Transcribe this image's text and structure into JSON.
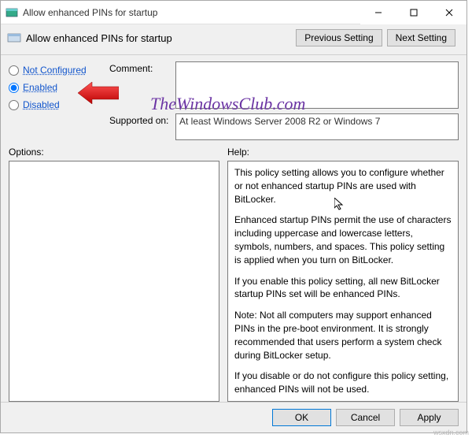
{
  "titlebar": {
    "title": "Allow enhanced PINs for startup"
  },
  "header": {
    "label": "Allow enhanced PINs for startup"
  },
  "nav": {
    "prev": "Previous Setting",
    "next": "Next Setting"
  },
  "radios": {
    "not_configured": "Not Configured",
    "enabled": "Enabled",
    "disabled": "Disabled",
    "selected": "enabled"
  },
  "comment": {
    "label": "Comment:",
    "value": ""
  },
  "supported": {
    "label": "Supported on:",
    "value": "At least Windows Server 2008 R2 or Windows 7"
  },
  "options": {
    "label": "Options:"
  },
  "help": {
    "label": "Help:",
    "p1": "This policy setting allows you to configure whether or not enhanced startup PINs are used with BitLocker.",
    "p2": "Enhanced startup PINs permit the use of characters including uppercase and lowercase letters, symbols, numbers, and spaces. This policy setting is applied when you turn on BitLocker.",
    "p3": "If you enable this policy setting, all new BitLocker startup PINs set will be enhanced PINs.",
    "p4": "Note:   Not all computers may support enhanced PINs in the pre-boot environment. It is strongly recommended that users perform a system check during BitLocker setup.",
    "p5": "If you disable or do not configure this policy setting, enhanced PINs will not be used."
  },
  "footer": {
    "ok": "OK",
    "cancel": "Cancel",
    "apply": "Apply"
  },
  "watermarks": {
    "site": "TheWindowsClub.com",
    "corner": "wsxdn.com"
  }
}
